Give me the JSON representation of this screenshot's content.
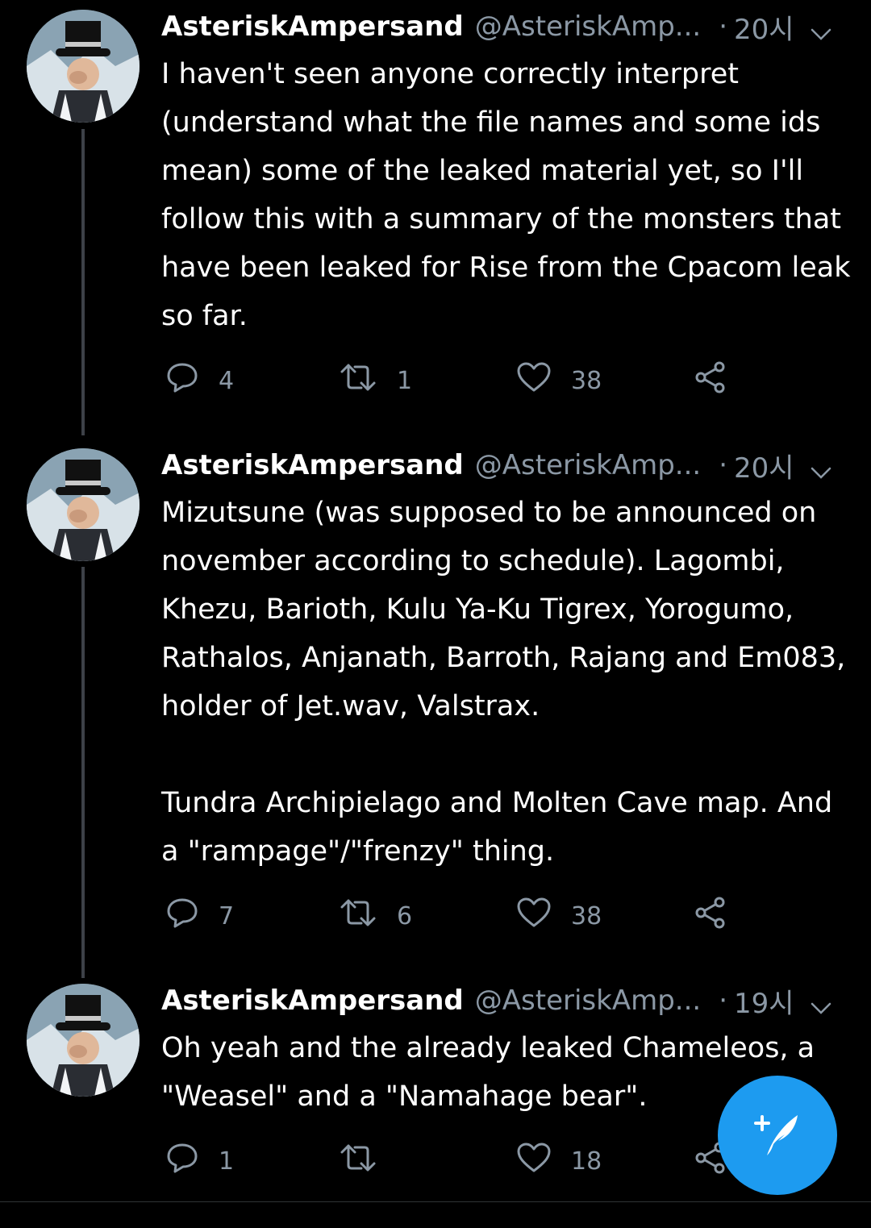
{
  "tweets": [
    {
      "author_name": "AsteriskAmpersand",
      "handle": "@AsteriskAmp...",
      "separator": "·",
      "time": "20시",
      "text": "I haven't seen anyone correctly interpret (understand what the file names and some ids mean) some of the leaked material yet, so I'll follow this with a summary of the monsters that have been leaked for Rise from the Cpacom leak so far.",
      "replies": "4",
      "retweets": "1",
      "likes": "38"
    },
    {
      "author_name": "AsteriskAmpersand",
      "handle": "@AsteriskAmp...",
      "separator": "·",
      "time": "20시",
      "text": "Mizutsune (was supposed to be announced on november according to schedule). Lagombi, Khezu, Barioth, Kulu Ya-Ku Tigrex, Yorogumo, Rathalos, Anjanath, Barroth, Rajang and Em083, holder of Jet.wav, Valstrax.\n\nTundra Archipielago and Molten Cave map. And a \"rampage\"/\"frenzy\" thing.",
      "replies": "7",
      "retweets": "6",
      "likes": "38"
    },
    {
      "author_name": "AsteriskAmpersand",
      "handle": "@AsteriskAmp...",
      "separator": "·",
      "time": "19시",
      "text": "Oh yeah and the already leaked Chameleos, a \"Weasel\" and a \"Namahage bear\".",
      "replies": "1",
      "retweets": "",
      "likes": "18"
    }
  ],
  "icons": {
    "reply": "reply-icon",
    "retweet": "retweet-icon",
    "like": "heart-icon",
    "share": "share-icon",
    "menu": "chevron-down-icon",
    "compose": "compose-tweet-icon"
  },
  "colors": {
    "background": "#000000",
    "text": "#ffffff",
    "secondary": "#8b98a5",
    "thread_line": "#3d4148",
    "accent": "#1d9bf0"
  }
}
